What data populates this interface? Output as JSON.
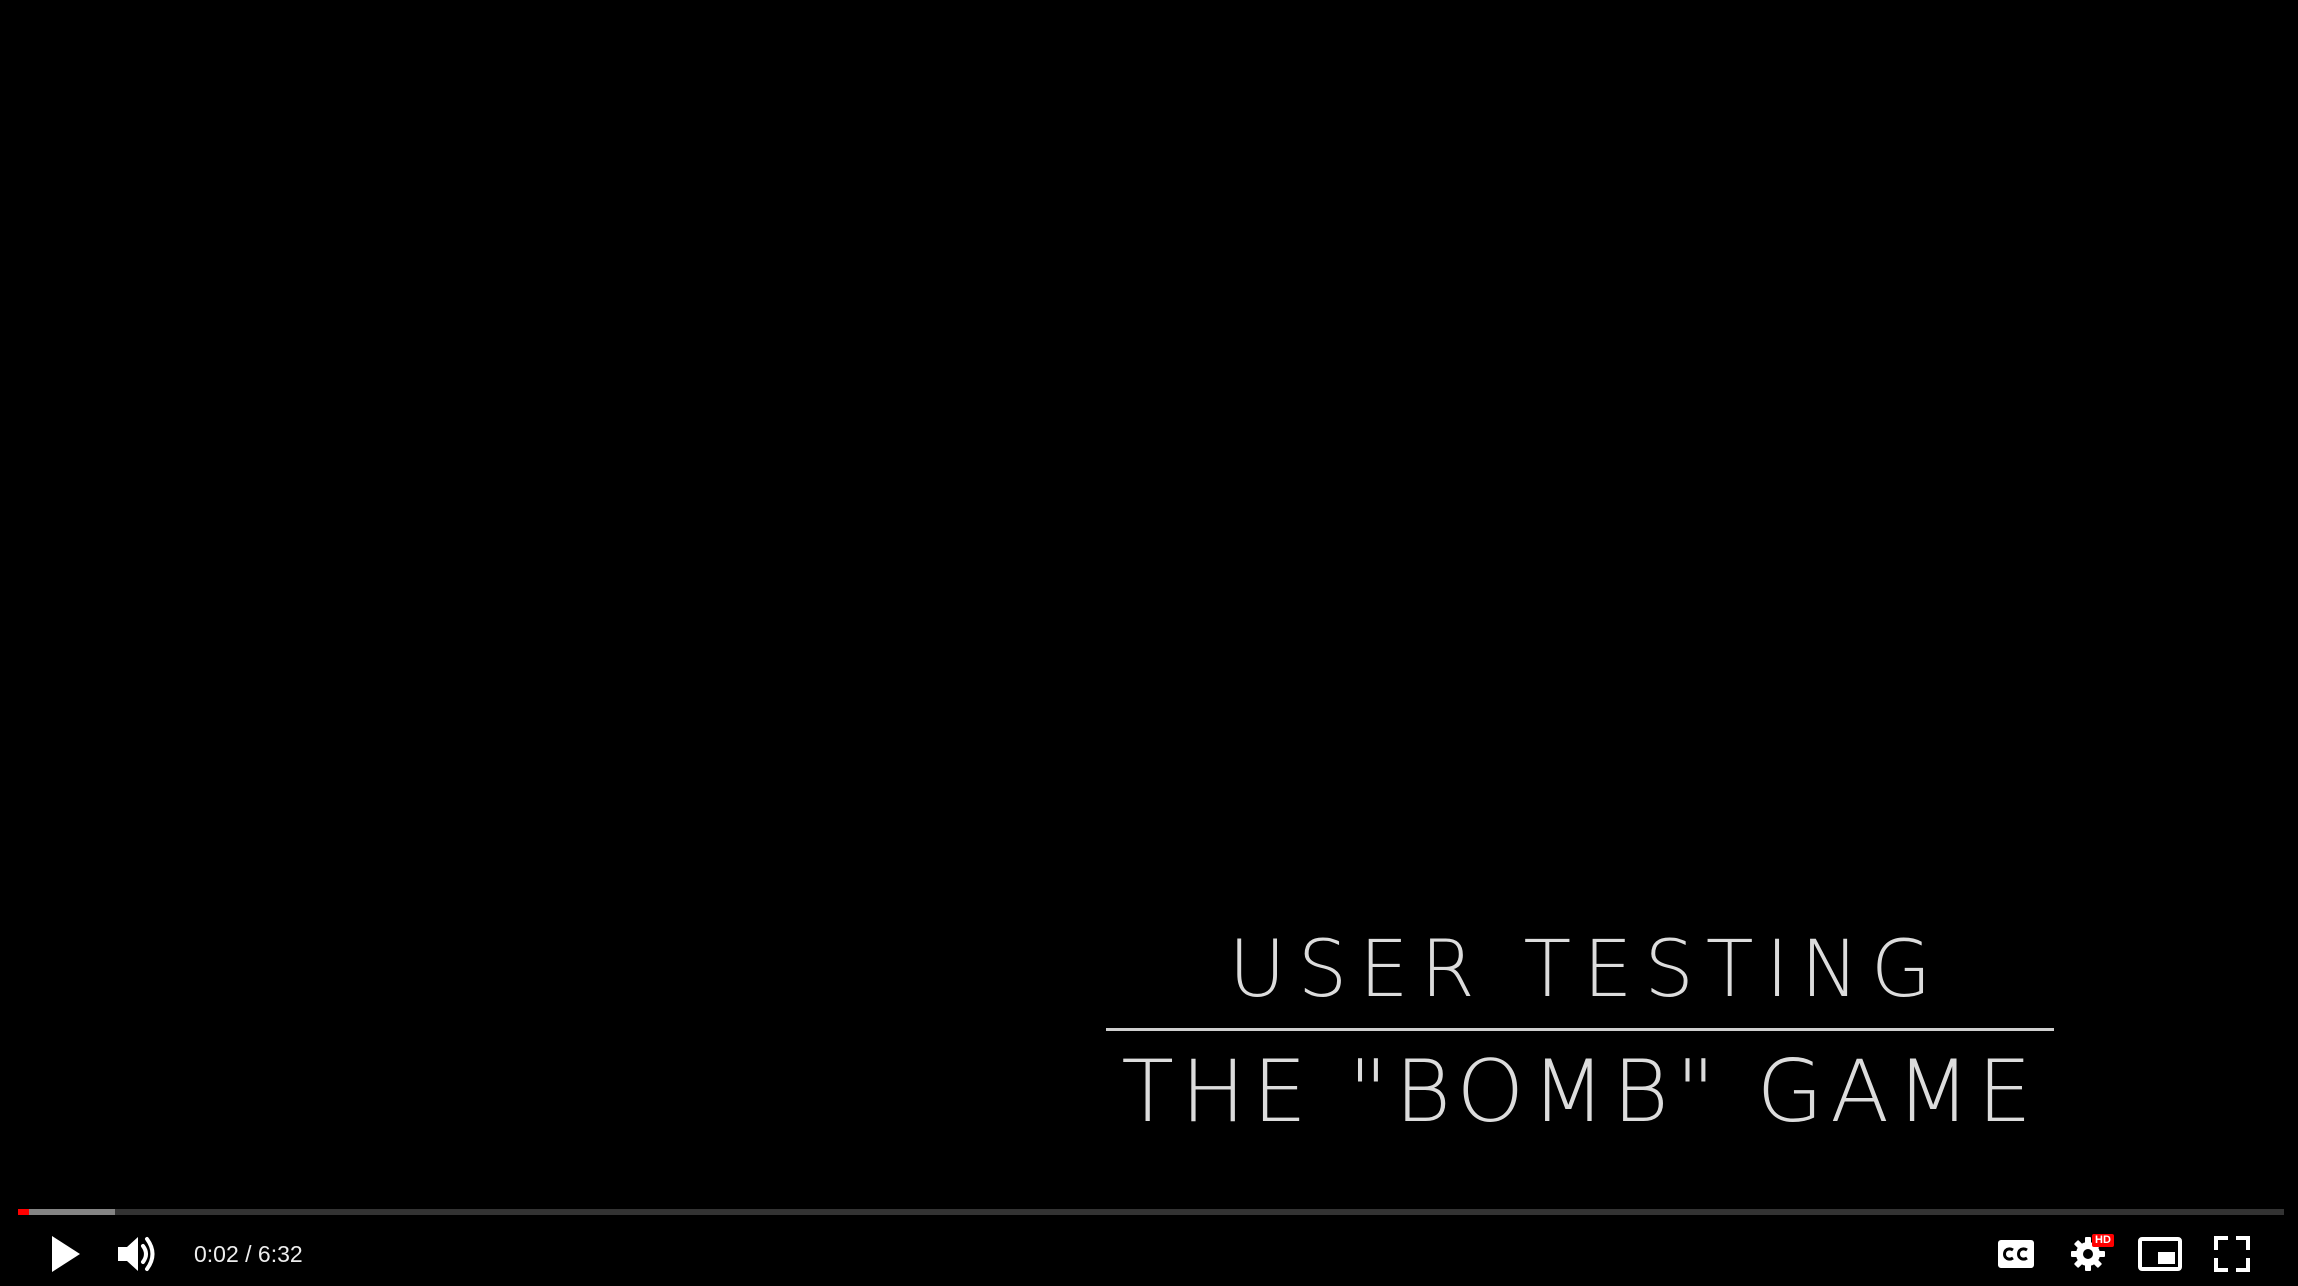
{
  "video": {
    "title_line_1": "USER TESTING",
    "title_line_2": "THE \"BOMB\" GAME"
  },
  "progress": {
    "played_fraction": 0.005,
    "loaded_fraction": 0.043,
    "played_color": "#ff0000"
  },
  "controls": {
    "time": "0:02 / 6:32",
    "quality_badge": "HD",
    "icons": {
      "play": "play-icon",
      "volume": "volume-icon",
      "captions": "captions-icon",
      "settings": "settings-gear-icon",
      "miniplayer": "miniplayer-icon",
      "fullscreen": "fullscreen-icon"
    }
  }
}
